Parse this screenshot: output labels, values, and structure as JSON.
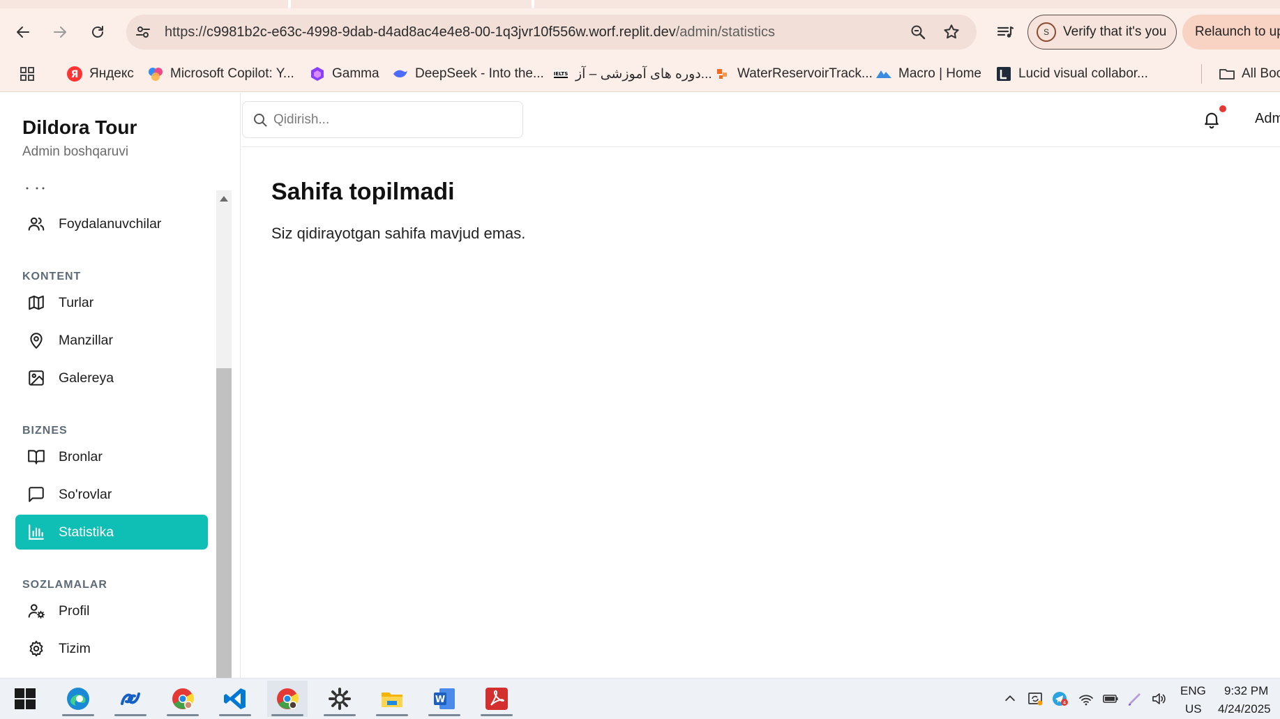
{
  "browser": {
    "url_prefix": "https://",
    "url_host": "c9981b2c-e63c-4998-9dab-d4ad8ac4e4e8-00-1q3jvr10f556w.worf.replit.dev",
    "url_path": "/admin/statistics",
    "verify_label": "Verify that it's you",
    "verify_avatar_letter": "S",
    "relaunch_label": "Relaunch to upd",
    "bookmarks": [
      {
        "label": "Яндекс",
        "icon": "yandex-icon"
      },
      {
        "label": "Microsoft Copilot: Y...",
        "icon": "copilot-icon"
      },
      {
        "label": "Gamma",
        "icon": "gamma-icon"
      },
      {
        "label": "DeepSeek - Into the...",
        "icon": "deepseek-icon"
      },
      {
        "label": "دوره های آموزشی – آز...",
        "icon": "ielts-icon"
      },
      {
        "label": "WaterReservoirTrack...",
        "icon": "water-icon"
      },
      {
        "label": "Macro | Home",
        "icon": "macro-icon"
      },
      {
        "label": "Lucid visual collabor...",
        "icon": "lucid-icon"
      },
      {
        "label": "All Boo",
        "icon": "folder-icon"
      }
    ]
  },
  "sidebar": {
    "title": "Dildora Tour",
    "subtitle": "Admin boshqaruvi",
    "items": [
      {
        "label": "Foydalanuvchilar",
        "icon": "users-icon"
      },
      {
        "label": "Turlar",
        "icon": "map-icon"
      },
      {
        "label": "Manzillar",
        "icon": "map-pin-icon"
      },
      {
        "label": "Galereya",
        "icon": "image-icon"
      },
      {
        "label": "Bronlar",
        "icon": "book-icon"
      },
      {
        "label": "So'rovlar",
        "icon": "message-icon"
      },
      {
        "label": "Statistika",
        "icon": "bar-chart-icon",
        "active": true
      },
      {
        "label": "Profil",
        "icon": "user-cog-icon"
      },
      {
        "label": "Tizim",
        "icon": "settings-icon"
      }
    ],
    "sections": {
      "kontent": "KONTENT",
      "biznes": "BIZNES",
      "sozlamalar": "SOZLAMALAR"
    }
  },
  "topbar": {
    "search_placeholder": "Qidirish...",
    "admin_label": "Adm"
  },
  "main": {
    "title": "Sahifa topilmadi",
    "message": "Siz qidirayotgan sahifa mavjud emas."
  },
  "taskbar": {
    "language": "ENG",
    "region": "US",
    "time": "9:32 PM",
    "date": "4/24/2025",
    "telegram_badge": "4"
  },
  "colors": {
    "accent": "#0fbfb5",
    "notification": "#e53935",
    "chrome_bg": "#fcefe9"
  }
}
